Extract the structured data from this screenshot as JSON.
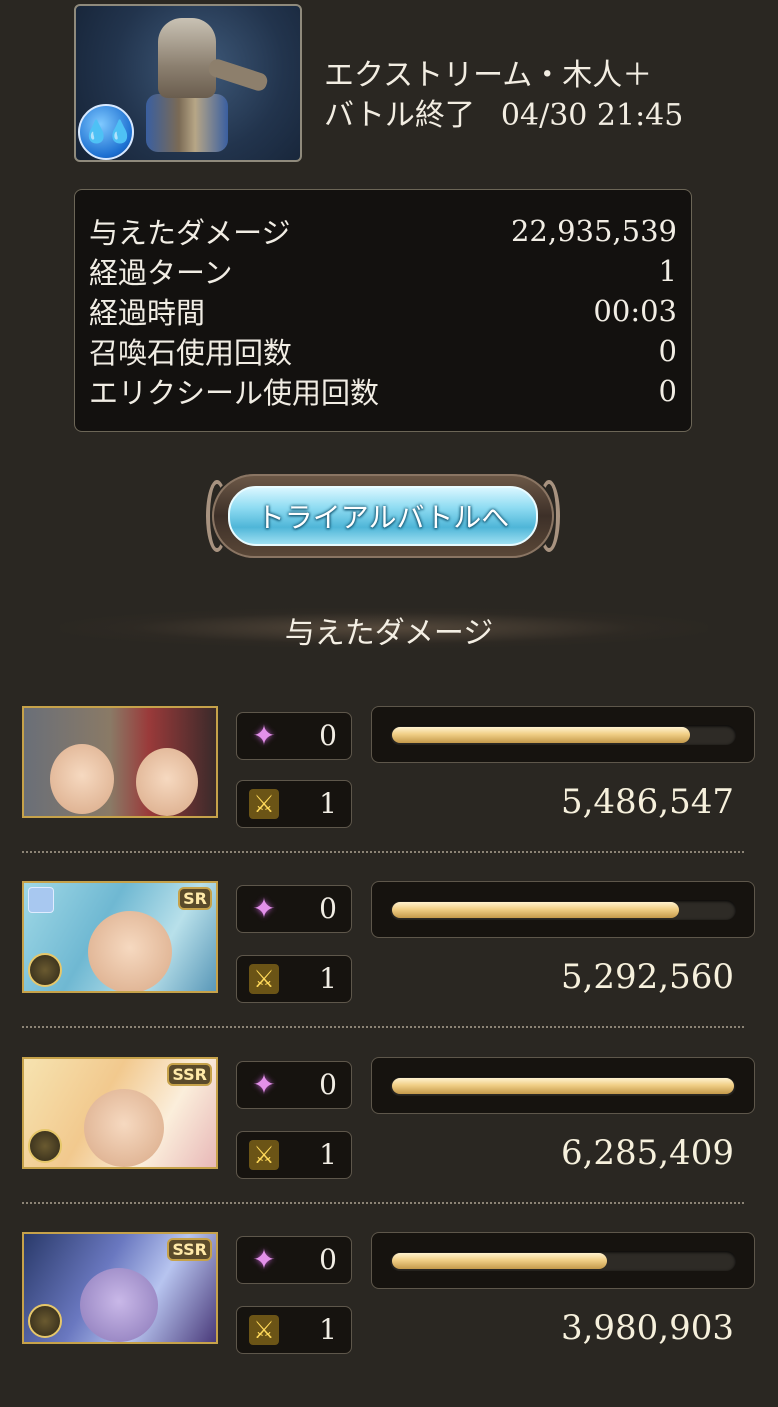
{
  "header": {
    "quest_title": "エクストリーム・木人＋",
    "status": "バトル終了",
    "timestamp": "04/30 21:45",
    "element_icon": "water-element-icon"
  },
  "stats": [
    {
      "label": "与えたダメージ",
      "value": "22,935,539"
    },
    {
      "label": "経過ターン",
      "value": "1"
    },
    {
      "label": "経過時間",
      "value": "00:03"
    },
    {
      "label": "召喚石使用回数",
      "value": "0"
    },
    {
      "label": "エリクシール使用回数",
      "value": "0"
    }
  ],
  "trial_button_label": "トライアルバトルへ",
  "section_title": "与えたダメージ",
  "characters": [
    {
      "skill_count": "0",
      "attack_count": "1",
      "damage": "5,486,547",
      "damage_ratio": 0.873,
      "rarity": ""
    },
    {
      "skill_count": "0",
      "attack_count": "1",
      "damage": "5,292,560",
      "damage_ratio": 0.842,
      "rarity": "SR"
    },
    {
      "skill_count": "0",
      "attack_count": "1",
      "damage": "6,285,409",
      "damage_ratio": 1.0,
      "rarity": "SSR"
    },
    {
      "skill_count": "0",
      "attack_count": "1",
      "damage": "3,980,903",
      "damage_ratio": 0.633,
      "rarity": "SSR"
    }
  ],
  "icons": {
    "skill": "burst-icon",
    "attack": "crossed-swords-icon"
  },
  "colors": {
    "background": "#2a2722",
    "bar_fill": "#f1cf86",
    "button_face": "#8fdcf2",
    "frame_gold": "#c6a24a"
  }
}
